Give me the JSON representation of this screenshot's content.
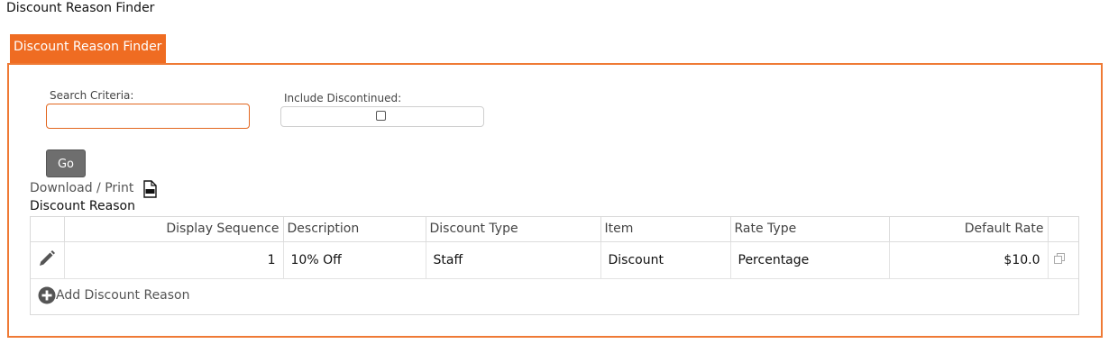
{
  "page_title": "Discount Reason Finder",
  "tab_label": "Discount Reason Finder",
  "search": {
    "label": "Search Criteria:",
    "value": "",
    "placeholder": ""
  },
  "include_discontinued": {
    "label": "Include Discontinued:",
    "checked": false
  },
  "go_label": "Go",
  "download_label": "Download / Print",
  "section_title": "Discount Reason",
  "columns": [
    "Display Sequence",
    "Description",
    "Discount Type",
    "Item",
    "Rate Type",
    "Default Rate"
  ],
  "rows": [
    {
      "display_sequence": "1",
      "description": "10% Off",
      "discount_type": "Staff",
      "item": "Discount",
      "rate_type": "Percentage",
      "default_rate": "$10.0"
    }
  ],
  "add_label": "Add Discount Reason",
  "colors": {
    "accent": "#ef6c22",
    "button": "#6e6e6e"
  },
  "icons": {
    "edit": "pencil-icon",
    "copy": "copy-icon",
    "download": "csv-file-icon",
    "add": "plus-circle-icon"
  }
}
